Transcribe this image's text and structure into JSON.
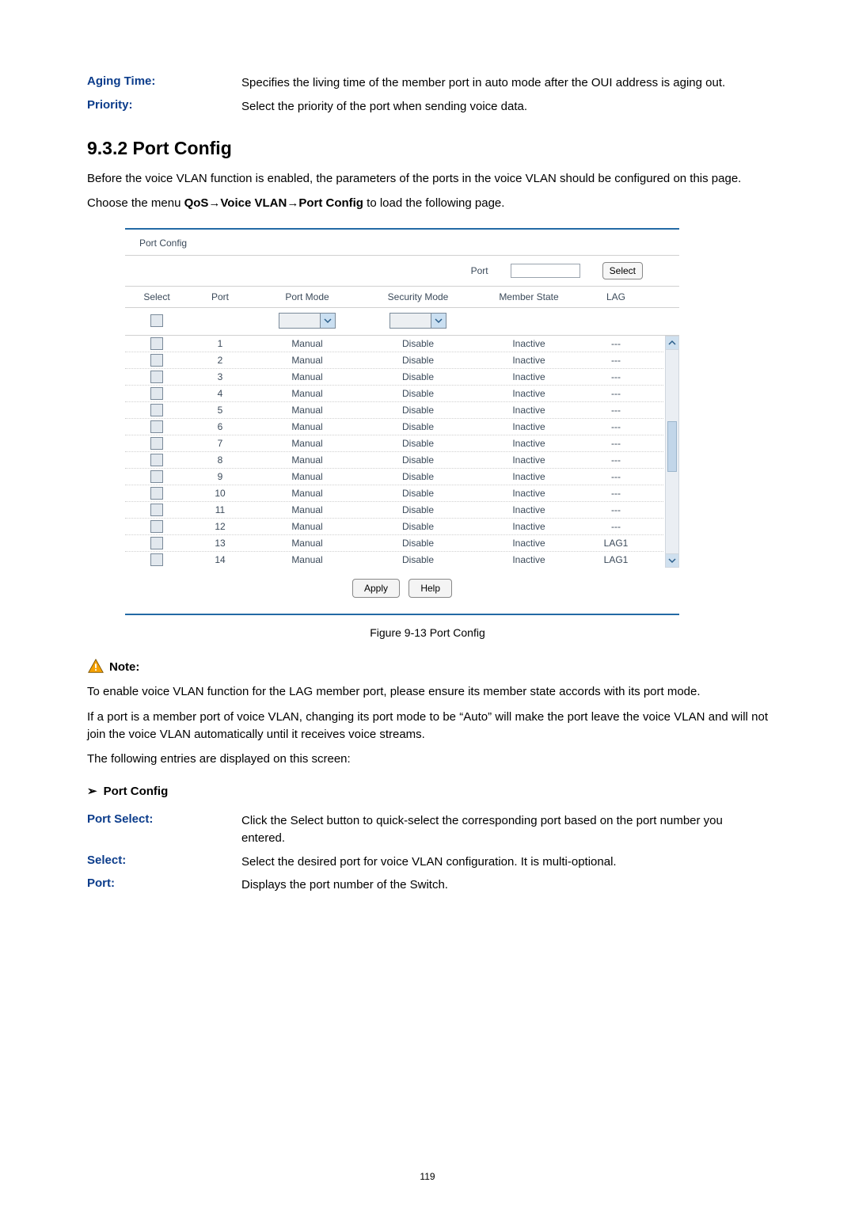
{
  "top_definitions": [
    {
      "label": "Aging Time:",
      "value": "Specifies the living time of the member port in auto mode after the OUI address is aging out."
    },
    {
      "label": "Priority:",
      "value": "Select the priority of the port when sending voice data."
    }
  ],
  "section_heading": "9.3.2 Port Config",
  "intro": "Before the voice VLAN function is enabled, the parameters of the ports in the voice VLAN should be configured on this page.",
  "menu_text_pre": "Choose the menu ",
  "menu_path": "QoS→Voice VLAN→Port Config",
  "menu_text_post": " to load the following page.",
  "panel": {
    "title": "Port Config",
    "filter": {
      "port_label": "Port",
      "port_value": "",
      "select_btn": "Select"
    },
    "headers": {
      "select": "Select",
      "port": "Port",
      "port_mode": "Port Mode",
      "security_mode": "Security Mode",
      "member_state": "Member State",
      "lag": "LAG"
    },
    "rows": [
      {
        "port": "1",
        "mode": "Manual",
        "sec": "Disable",
        "state": "Inactive",
        "lag": "---"
      },
      {
        "port": "2",
        "mode": "Manual",
        "sec": "Disable",
        "state": "Inactive",
        "lag": "---"
      },
      {
        "port": "3",
        "mode": "Manual",
        "sec": "Disable",
        "state": "Inactive",
        "lag": "---"
      },
      {
        "port": "4",
        "mode": "Manual",
        "sec": "Disable",
        "state": "Inactive",
        "lag": "---"
      },
      {
        "port": "5",
        "mode": "Manual",
        "sec": "Disable",
        "state": "Inactive",
        "lag": "---"
      },
      {
        "port": "6",
        "mode": "Manual",
        "sec": "Disable",
        "state": "Inactive",
        "lag": "---"
      },
      {
        "port": "7",
        "mode": "Manual",
        "sec": "Disable",
        "state": "Inactive",
        "lag": "---"
      },
      {
        "port": "8",
        "mode": "Manual",
        "sec": "Disable",
        "state": "Inactive",
        "lag": "---"
      },
      {
        "port": "9",
        "mode": "Manual",
        "sec": "Disable",
        "state": "Inactive",
        "lag": "---"
      },
      {
        "port": "10",
        "mode": "Manual",
        "sec": "Disable",
        "state": "Inactive",
        "lag": "---"
      },
      {
        "port": "11",
        "mode": "Manual",
        "sec": "Disable",
        "state": "Inactive",
        "lag": "---"
      },
      {
        "port": "12",
        "mode": "Manual",
        "sec": "Disable",
        "state": "Inactive",
        "lag": "---"
      },
      {
        "port": "13",
        "mode": "Manual",
        "sec": "Disable",
        "state": "Inactive",
        "lag": "LAG1"
      },
      {
        "port": "14",
        "mode": "Manual",
        "sec": "Disable",
        "state": "Inactive",
        "lag": "LAG1"
      }
    ],
    "buttons": {
      "apply": "Apply",
      "help": "Help"
    }
  },
  "figure_caption": "Figure 9-13 Port Config",
  "note_label": "Note:",
  "note_p1": "To enable voice VLAN function for the LAG member port, please ensure its member state accords with its port mode.",
  "note_p2": "If a port is a member port of voice VLAN, changing its port mode to be “Auto” will make the port leave the voice VLAN and will not join the voice VLAN automatically until it receives voice streams.",
  "entries_intro": "The following entries are displayed on this screen:",
  "sub_heading": "Port Config",
  "bottom_definitions": [
    {
      "label": "Port Select:",
      "value": "Click the Select button to quick-select the corresponding port based on the port number you entered."
    },
    {
      "label": "Select:",
      "value": "Select the desired port for voice VLAN configuration. It is multi-optional."
    },
    {
      "label": "Port:",
      "value": "Displays the port number of the Switch."
    }
  ],
  "page_number": "119"
}
